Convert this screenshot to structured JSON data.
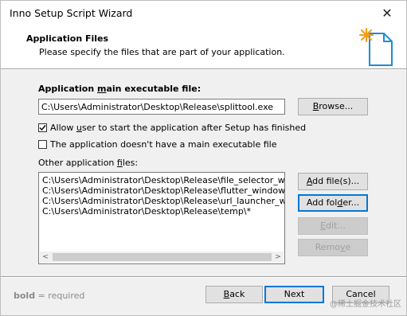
{
  "window": {
    "title": "Inno Setup Script Wizard",
    "close_glyph": "✕"
  },
  "header": {
    "title": "Application Files",
    "description": "Please specify the files that are part of your application.",
    "icon": "wizard-document-icon"
  },
  "main_exe": {
    "label_pre": "Application ",
    "label_accel": "m",
    "label_post": "ain executable file:",
    "value": "C:\\Users\\Administrator\\Desktop\\Release\\splittool.exe",
    "browse_pre": "",
    "browse_accel": "B",
    "browse_post": "rowse..."
  },
  "options": {
    "allow_user_pre": "Allow ",
    "allow_user_accel": "u",
    "allow_user_post": "ser to start the application after Setup has finished",
    "allow_user_checked": true,
    "no_main_pre": "The application doesn't have a main executable file",
    "no_main_checked": false
  },
  "other_files": {
    "label_pre": "Other application ",
    "label_accel": "f",
    "label_post": "iles:",
    "items": [
      "C:\\Users\\Administrator\\Desktop\\Release\\file_selector_windows",
      "C:\\Users\\Administrator\\Desktop\\Release\\flutter_windows.dll",
      "C:\\Users\\Administrator\\Desktop\\Release\\url_launcher_windows",
      "C:\\Users\\Administrator\\Desktop\\Release\\temp\\*"
    ],
    "add_files_pre": "",
    "add_files_accel": "A",
    "add_files_post": "dd file(s)...",
    "add_folder_pre": "Add fol",
    "add_folder_accel": "d",
    "add_folder_post": "er...",
    "edit_pre": "",
    "edit_accel": "E",
    "edit_post": "dit...",
    "remove_pre": "Remo",
    "remove_accel": "v",
    "remove_post": "e",
    "scroll_left": "<",
    "scroll_right": ">"
  },
  "footer": {
    "bold_word": "bold",
    "note_rest": " = required",
    "back_pre": "",
    "back_accel": "B",
    "back_post": "ack",
    "next_label": "Next",
    "cancel_label": "Cancel",
    "watermark": "@稀土掘金技术社区"
  },
  "colors": {
    "accent": "#0078d7",
    "icon_star": "#f39c12",
    "icon_doc": "#1f8bd6"
  }
}
